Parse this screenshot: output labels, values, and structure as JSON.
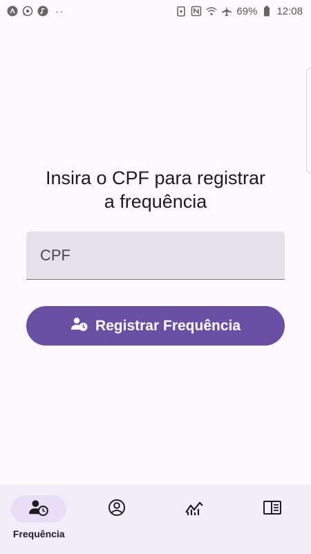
{
  "status_bar": {
    "battery_percent": "69%",
    "time": "12:08",
    "left_icons": [
      "app-icon",
      "whatsapp-icon",
      "music-icon"
    ],
    "right_icons": [
      "battery-saver-icon",
      "nfc-icon",
      "wifi-icon",
      "airplane-icon",
      "battery-icon"
    ]
  },
  "main": {
    "prompt_line1": "Insira o CPF para registrar",
    "prompt_line2": "a frequência",
    "cpf_field": {
      "placeholder": "CPF",
      "value": ""
    },
    "register_button": {
      "label": "Registrar Frequência",
      "icon": "person-clock-icon"
    }
  },
  "bottom_nav": {
    "items": [
      {
        "label": "Frequência",
        "icon": "person-clock-icon",
        "active": true
      },
      {
        "label": "",
        "icon": "account-circle-icon",
        "active": false
      },
      {
        "label": "",
        "icon": "trend-chart-icon",
        "active": false
      },
      {
        "label": "",
        "icon": "book-icon",
        "active": false
      }
    ]
  },
  "colors": {
    "background": "#fdf8fc",
    "primary": "#6a50a5",
    "field_fill": "#e6e0e9",
    "nav_background": "#f3edf7",
    "nav_active_pill": "#e8def8"
  }
}
